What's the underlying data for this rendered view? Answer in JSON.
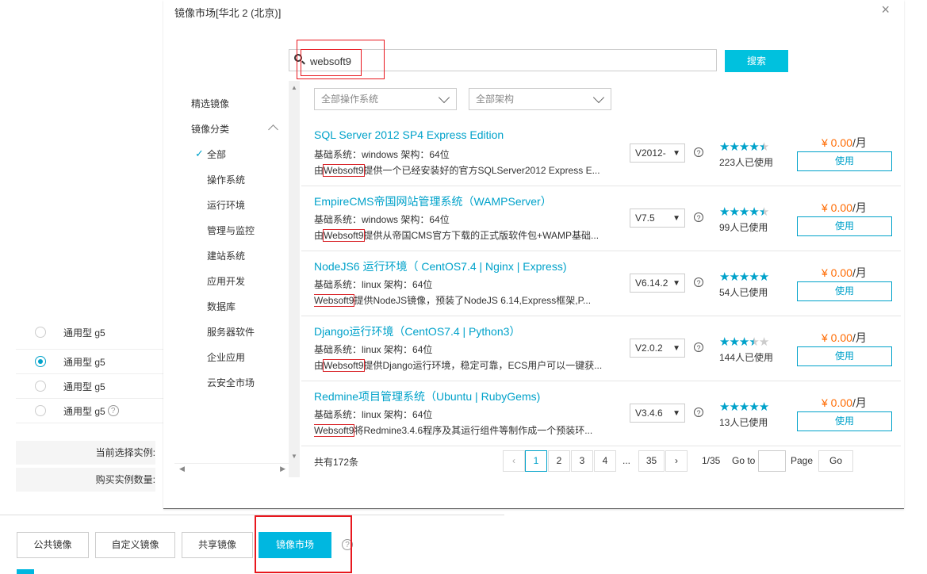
{
  "background": {
    "radio_rows": [
      {
        "label": "通用型 g5",
        "selected": false
      },
      {
        "label": "通用型 g5",
        "selected": true
      },
      {
        "label": "通用型 g5",
        "selected": false
      },
      {
        "label": "通用型 g5",
        "selected": false
      }
    ],
    "current_instance_label": "当前选择实例:",
    "buy_count_label": "购买实例数量:",
    "image_tabs": [
      "公共镜像",
      "自定义镜像",
      "共享镜像",
      "镜像市场"
    ],
    "active_tab": "镜像市场",
    "help_glyph": "?"
  },
  "modal": {
    "title": "镜像市场[华北 2 (北京)]",
    "close_glyph": "×",
    "search": {
      "value": "websoft9",
      "button": "搜索"
    },
    "sidebar": {
      "featured": "精选镜像",
      "category": "镜像分类",
      "items": [
        "全部",
        "操作系统",
        "运行环境",
        "管理与监控",
        "建站系统",
        "应用开发",
        "数据库",
        "服务器软件",
        "企业应用",
        "云安全市场"
      ],
      "selected": "全部"
    },
    "filters": {
      "os": "全部操作系统",
      "arch": "全部架构"
    },
    "results": [
      {
        "title": "SQL Server 2012 SP4 Express Edition",
        "meta": "基础系统：windows      架构：64位",
        "desc_prefix": "由",
        "vendor": "Websoft9",
        "desc": "提供一个已经安装好的官方SQLServer2012 Express E...",
        "version": "V2012-",
        "rating": 4.5,
        "users": "223人已使用",
        "price": "¥ 0.00",
        "unit": "/月",
        "button": "使用"
      },
      {
        "title": "EmpireCMS帝国网站管理系统（WAMPServer）",
        "meta": "基础系统：windows      架构：64位",
        "desc_prefix": "由",
        "vendor": "Websoft9",
        "desc": "提供从帝国CMS官方下载的正式版软件包+WAMP基础...",
        "version": "V7.5",
        "rating": 4.5,
        "users": "99人已使用",
        "price": "¥ 0.00",
        "unit": "/月",
        "button": "使用"
      },
      {
        "title": "NodeJS6 运行环境（ CentOS7.4 | Nginx | Express)",
        "meta": "基础系统：linux      架构：64位",
        "desc_prefix": "",
        "vendor": "Websoft9",
        "desc": "提供NodeJS镜像，预装了NodeJS 6.14,Express框架,P...",
        "version": "V6.14.2",
        "rating": 5,
        "users": "54人已使用",
        "price": "¥ 0.00",
        "unit": "/月",
        "button": "使用"
      },
      {
        "title": "Django运行环境（CentOS7.4 | Python3）",
        "meta": "基础系统：linux      架构：64位",
        "desc_prefix": "由",
        "vendor": "Websoft9",
        "desc": "提供Django运行环境，稳定可靠，ECS用户可以一键获...",
        "version": "V2.0.2",
        "rating": 3.5,
        "users": "144人已使用",
        "price": "¥ 0.00",
        "unit": "/月",
        "button": "使用"
      },
      {
        "title": "Redmine项目管理系统（Ubuntu | RubyGems)",
        "meta": "基础系统：linux      架构：64位",
        "desc_prefix": "",
        "vendor": "Websoft9",
        "desc": "将Redmine3.4.6程序及其运行组件等制作成一个预装环...",
        "version": "V3.4.6",
        "rating": 5,
        "users": "13人已使用",
        "price": "¥ 0.00",
        "unit": "/月",
        "button": "使用"
      }
    ],
    "pager": {
      "total": "共有172条",
      "prev": "‹",
      "next": "›",
      "pages": [
        "1",
        "2",
        "3",
        "4"
      ],
      "current": "1",
      "ellipsis": "...",
      "last": "35",
      "count": "1/35",
      "goto": "Go to",
      "page_label": "Page",
      "go": "Go"
    }
  },
  "colors": {
    "accent": "#00a2ca",
    "button": "#00c1de",
    "price": "#ff6a00",
    "highlight": "#e8171e"
  }
}
